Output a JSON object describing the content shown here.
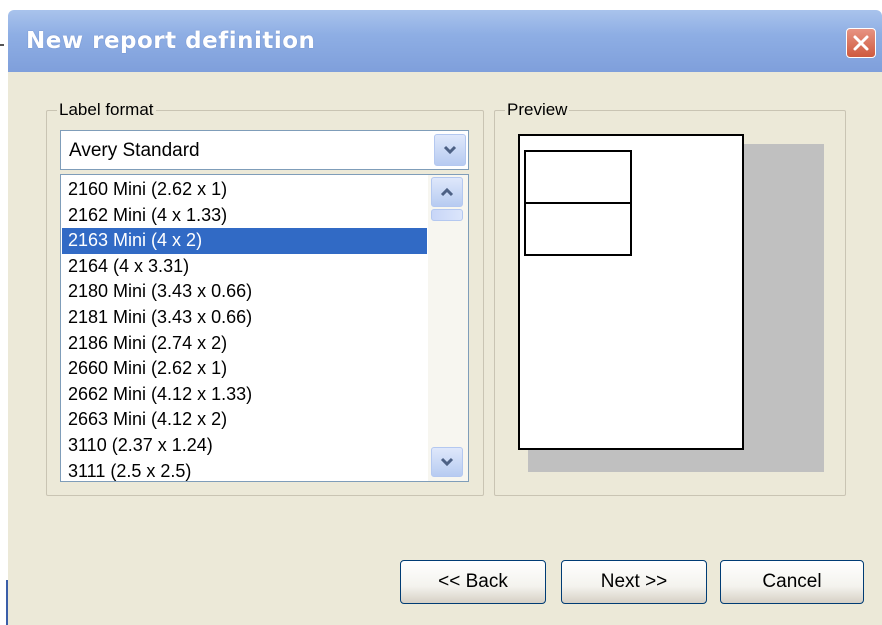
{
  "window": {
    "title": "New report definition"
  },
  "label_format": {
    "group_label": "Label format",
    "selected_vendor": "Avery Standard",
    "items": [
      "2160 Mini (2.62 x 1)",
      "2162 Mini (4 x 1.33)",
      "2163 Mini (4 x 2)",
      "2164 (4 x 3.31)",
      "2180 Mini (3.43 x 0.66)",
      "2181 Mini (3.43 x 0.66)",
      "2186 Mini (2.74 x 2)",
      "2660 Mini (2.62 x 1)",
      "2662 Mini (4.12 x 1.33)",
      "2663 Mini (4.12 x 2)",
      "3110 (2.37 x 1.24)",
      "3111 (2.5 x 2.5)"
    ],
    "selected_item": "2163 Mini (4 x 2)"
  },
  "preview": {
    "group_label": "Preview"
  },
  "buttons": {
    "back": "<< Back",
    "next": "Next >>",
    "cancel": "Cancel"
  },
  "colors": {
    "titlebar": "#8eaee4",
    "selection": "#316ac5",
    "dialog_background": "#ece9d8",
    "close_button": "#cf5a3e"
  },
  "icons": {
    "close": "close-icon",
    "dropdown": "chevron-down-icon",
    "scroll_up": "chevron-up-icon",
    "scroll_down": "chevron-down-icon"
  }
}
